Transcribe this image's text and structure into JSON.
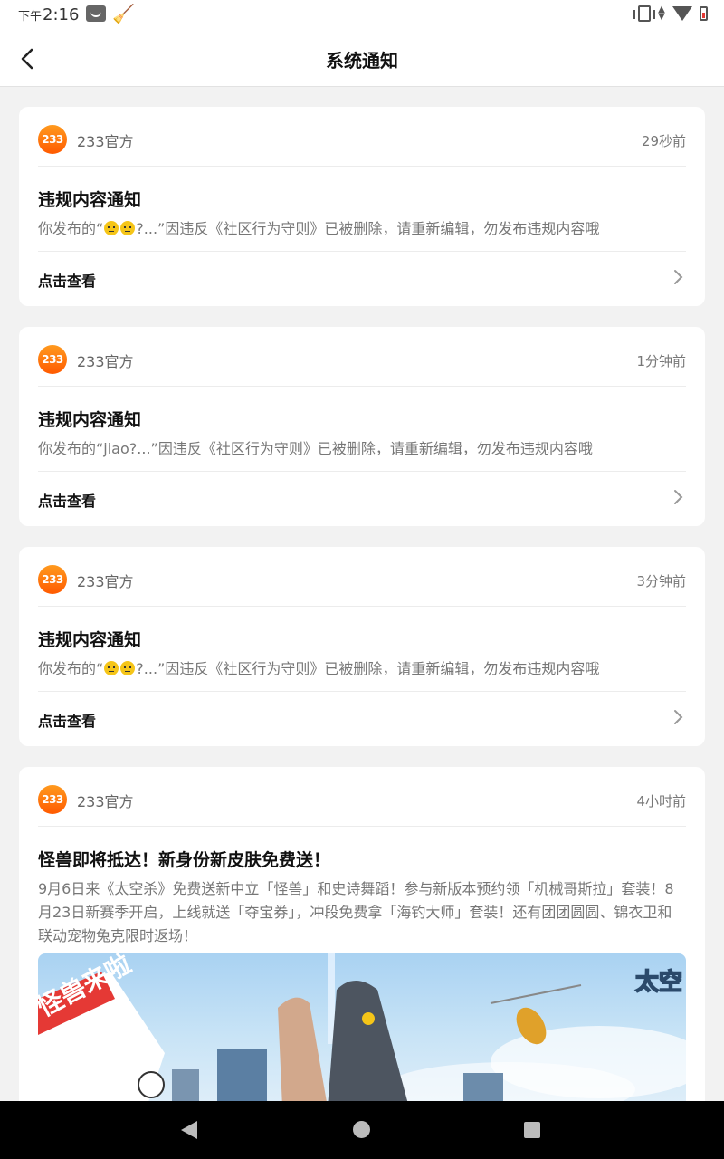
{
  "status_bar": {
    "ampm": "下午",
    "time": "2:16"
  },
  "header": {
    "title": "系统通知"
  },
  "notifications": [
    {
      "logo_text": "233",
      "sender": "233官方",
      "time": "29秒前",
      "title": "违规内容通知",
      "desc_prefix": "你发布的“",
      "desc_suffix": "?...”因违反《社区行为守则》已被删除，请重新编辑，勿发布违规内容哦",
      "link": "点击查看"
    },
    {
      "logo_text": "233",
      "sender": "233官方",
      "time": "1分钟前",
      "title": "违规内容通知",
      "desc": "你发布的“jiao?...”因违反《社区行为守则》已被删除，请重新编辑，勿发布违规内容哦",
      "link": "点击查看"
    },
    {
      "logo_text": "233",
      "sender": "233官方",
      "time": "3分钟前",
      "title": "违规内容通知",
      "desc_prefix": "你发布的“",
      "desc_suffix": "?...”因违反《社区行为守则》已被删除，请重新编辑，勿发布违规内容哦",
      "link": "点击查看"
    },
    {
      "logo_text": "233",
      "sender": "233官方",
      "time": "4小时前",
      "title": "怪兽即将抵达！新身份新皮肤免费送！",
      "desc": "9月6日来《太空杀》免费送新中立「怪兽」和史诗舞蹈！参与新版本预约领「机械哥斯拉」套装！8月23日新赛季开启，上线就送「夺宝券」，冲段免费拿「海钓大师」套装！还有团团圆圆、锦衣卫和联动宠物兔克限时返场！",
      "banner_text": "怪兽来啦",
      "banner_brand": "太空"
    }
  ]
}
